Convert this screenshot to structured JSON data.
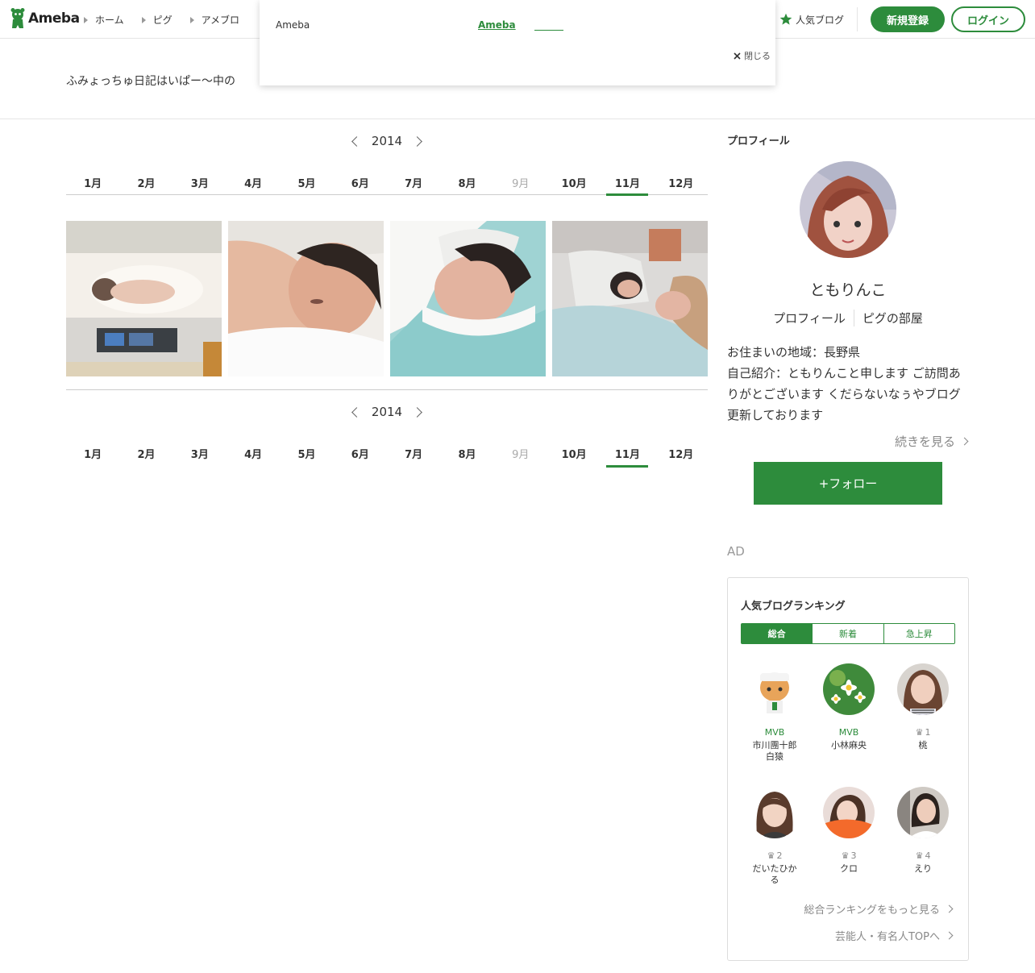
{
  "header": {
    "logo": "Ameba",
    "nav": [
      "ホーム",
      "ピグ",
      "アメブロ"
    ],
    "popular_blog": "人気ブログ",
    "register_label": "新規登録",
    "login_label": "ログイン"
  },
  "popup": {
    "brand": "Ameba",
    "link": "Ameba",
    "close_label": "閉じる"
  },
  "blog": {
    "title": "ふみょっちゅ日記はいぱー〜中の"
  },
  "archive": {
    "year": "2014",
    "months": [
      "1月",
      "2月",
      "3月",
      "4月",
      "5月",
      "6月",
      "7月",
      "8月",
      "9月",
      "10月",
      "11月",
      "12月"
    ],
    "disabled_month": "9月",
    "active_month": "11月",
    "photos": [
      "newborn-incubator",
      "newborn-lying",
      "newborn-swaddled",
      "mother-and-baby"
    ]
  },
  "profile": {
    "heading": "プロフィール",
    "name": "ともりんこ",
    "link_profile": "プロフィール",
    "link_pig": "ピグの部屋",
    "location": "お住まいの地域：長野県",
    "intro": "自己紹介：ともりんこと申します ご訪問ありがとございます くだらないなぅやブログ更新しております",
    "more": "続きを見る",
    "follow": "+フォロー"
  },
  "ad_label": "AD",
  "ranking": {
    "title": "人気ブログランキング",
    "tabs": [
      "総合",
      "新着",
      "急上昇"
    ],
    "entries": [
      {
        "badge": "MVB",
        "name": "市川團十郎白猿"
      },
      {
        "badge": "MVB",
        "name": "小林麻央"
      },
      {
        "badge": "1",
        "name": "桃"
      },
      {
        "badge": "2",
        "name": "だいたひかる"
      },
      {
        "badge": "3",
        "name": "クロ"
      },
      {
        "badge": "4",
        "name": "えり"
      }
    ],
    "more_total": "総合ランキングをもっと見る",
    "more_celeb": "芸能人・有名人TOPへ"
  },
  "colors": {
    "accent": "#2d8c3c"
  }
}
